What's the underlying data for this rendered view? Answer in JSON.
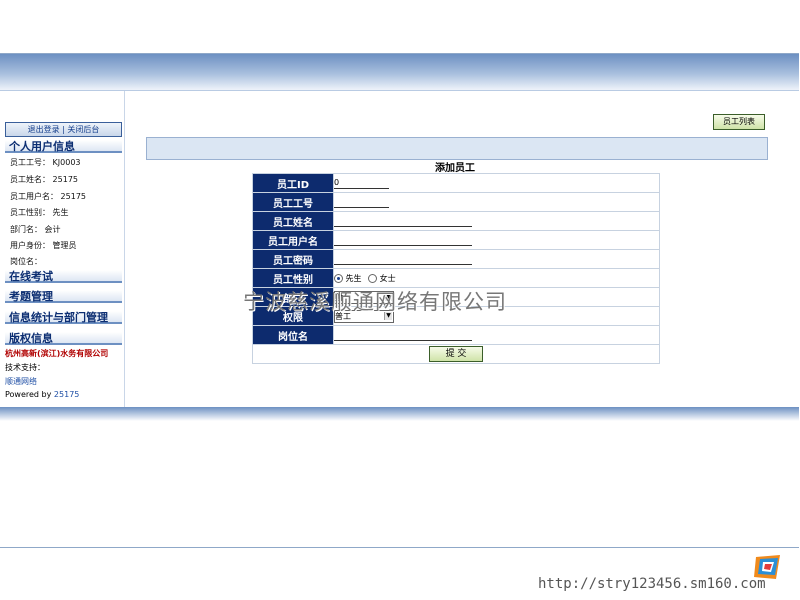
{
  "sidebar": {
    "top_links": [
      "退出登录",
      "关闭后台"
    ],
    "separator": "|",
    "sections": {
      "personal": "个人用户信息",
      "exam": "在线考试",
      "exam_mgmt": "考题管理",
      "stats": "信息统计与部门管理",
      "copyright": "版权信息"
    },
    "info": [
      {
        "label": "员工工号：",
        "value": "KJ0003"
      },
      {
        "label": "员工姓名：",
        "value": "25175"
      },
      {
        "label": "员工用户名：",
        "value": "25175"
      },
      {
        "label": "员工性别：",
        "value": "先生"
      },
      {
        "label": "部门名：",
        "value": "会计"
      },
      {
        "label": "用户身份：",
        "value": "管理员"
      },
      {
        "label": "岗位名：",
        "value": ""
      }
    ],
    "company": "杭州高新(滨江)水务有限公司",
    "support_label": "技术支持：",
    "support_link": "顺通网络",
    "powered_by_label": "Powered by",
    "powered_by_value": "25175"
  },
  "main": {
    "list_button": "员工列表",
    "form_title": "添加员工",
    "fields": {
      "id": {
        "label": "员工ID",
        "value": "0"
      },
      "no": {
        "label": "员工工号",
        "value": ""
      },
      "name": {
        "label": "员工姓名",
        "value": ""
      },
      "username": {
        "label": "员工用户名",
        "value": ""
      },
      "password": {
        "label": "员工密码",
        "value": ""
      },
      "gender": {
        "label": "员工性别",
        "options": [
          "先生",
          "女士"
        ],
        "selected": "先生"
      },
      "dept": {
        "label": "部门",
        "value": "财"
      },
      "role": {
        "label": "权限",
        "value": "普工"
      },
      "post": {
        "label": "岗位名",
        "value": ""
      }
    },
    "submit": "提 交"
  },
  "watermark": "宁波慈溪顺通网络有限公司",
  "site_url": "http://stry123456.sm160.com",
  "colors": {
    "label_bg": "#0d2b6e",
    "header_blue": "#6d90c2",
    "section_text": "#0c2e72",
    "company_red": "#b00000"
  }
}
